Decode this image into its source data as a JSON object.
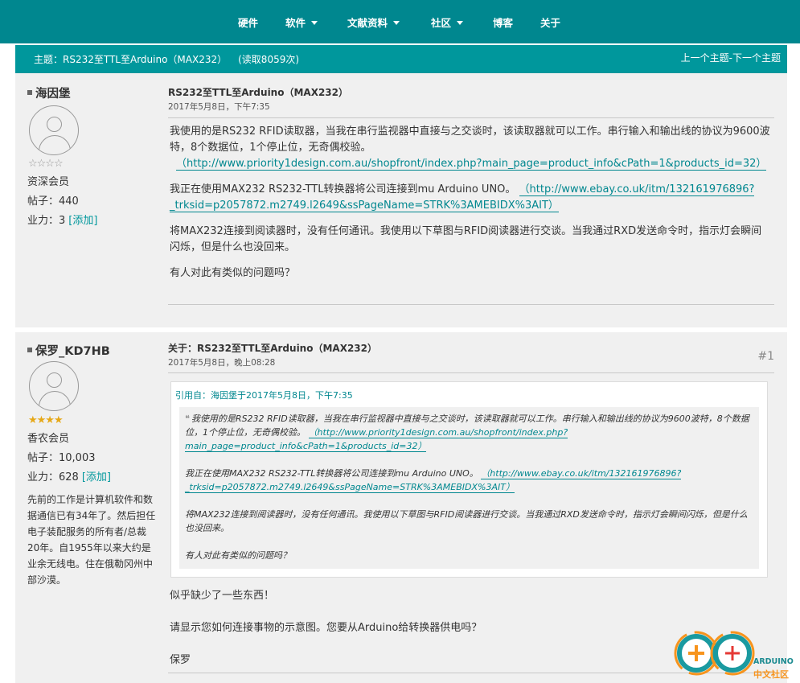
{
  "nav": {
    "items": [
      {
        "label": "硬件",
        "dropdown": false
      },
      {
        "label": "软件",
        "dropdown": true
      },
      {
        "label": "文献资料",
        "dropdown": true
      },
      {
        "label": "社区",
        "dropdown": true
      },
      {
        "label": "博客",
        "dropdown": false
      },
      {
        "label": "关于",
        "dropdown": false
      }
    ]
  },
  "topic": {
    "title": "主题：RS232至TTL至Arduino（MAX232）",
    "reads": "(读取8059次)",
    "nav_label": "上一个主题-下一个主题"
  },
  "posts": [
    {
      "username": "海因堡",
      "stars": "☆☆☆☆",
      "rank": "资深会员",
      "posts_label": "帖子：440",
      "karma_label": "业力：3",
      "add_label": "[添加]",
      "title": "RS232至TTL至Arduino（MAX232）",
      "date": "2017年5月8日，下午7:35",
      "paragraphs": {
        "p1": " 我使用的是RS232 RFID读取器，当我在串行监视器中直接与之交谈时，该读取器就可以工作。串行输入和输出线的协议为9600波特，8个数据位，1个停止位，无奇偶校验。",
        "p1_link": "（http://www.priority1design.com.au/shopfront/index.php?main_page=product_info&cPath=1&products_id=32）",
        "p2": "我正在使用MAX232 RS232-TTL转换器将公司连接到mu Arduino UNO。",
        "p2_link": "（http://www.ebay.co.uk/itm/132161976896?_trksid=p2057872.m2749.l2649&ssPageName=STRK%3AMEBIDX%3AIT）",
        "p3": "将MAX232连接到阅读器时，没有任何通讯。我使用以下草图与RFID阅读器进行交谈。当我通过RXD发送命令时，指示灯会瞬间闪烁，但是什么也没回来。",
        "p4": "有人对此有类似的问题吗？"
      }
    },
    {
      "username": "保罗_KD7HB",
      "stars": "★★★★",
      "rank": "香农会员",
      "posts_label": "帖子：10,003",
      "karma_label": "业力：628",
      "add_label": "[添加]",
      "bio": "先前的工作是计算机软件和数据通信已有34年了。然后担任电子装配服务的所有者/总裁20年。自1955年以来大约是业余无线电。住在俄勒冈州中部沙漠。",
      "title": "关于：RS232至TTL至Arduino（MAX232）",
      "date": "2017年5月8日，晚上08:28",
      "number": "#1",
      "quote": {
        "header": "引用自：海因堡于2017年5月8日，下午7:35",
        "q1": "我使用的是RS232 RFID读取器，当我在串行监视器中直接与之交谈时，该读取器就可以工作。串行输入和输出线的协议为9600波特，8个数据位，1个停止位，无奇偶校验。",
        "q1_link": "（http://www.priority1design.com.au/shopfront/index.php?main_page=product_info&cPath=1&products_id=32）",
        "q2": "我正在使用MAX232 RS232-TTL转换器将公司连接到mu Arduino UNO。",
        "q2_link": "（http://www.ebay.co.uk/itm/132161976896?_trksid=p2057872.m2749.l2649&ssPageName=STRK%3AMEBIDX%3AIT）",
        "q3": "将MAX232连接到阅读器时，没有任何通讯。我使用以下草图与RFID阅读器进行交谈。当我通过RXD发送命令时，指示灯会瞬间闪烁，但是什么也没回来。",
        "q4": "有人对此有类似的问题吗？"
      },
      "reply": {
        "r1": "似乎缺少了一些东西！",
        "r2": "请显示您如何连接事物的示意图。您要从Arduino给转换器供电吗？",
        "r3": "保罗"
      }
    }
  ],
  "watermark": {
    "line1": "ARDUINO",
    "line2": "中文社区"
  },
  "colors": {
    "nav_bg": "#00878f",
    "topic_bar": "#00979c",
    "link": "#00878f",
    "post_bg": "#f0f0f0"
  }
}
